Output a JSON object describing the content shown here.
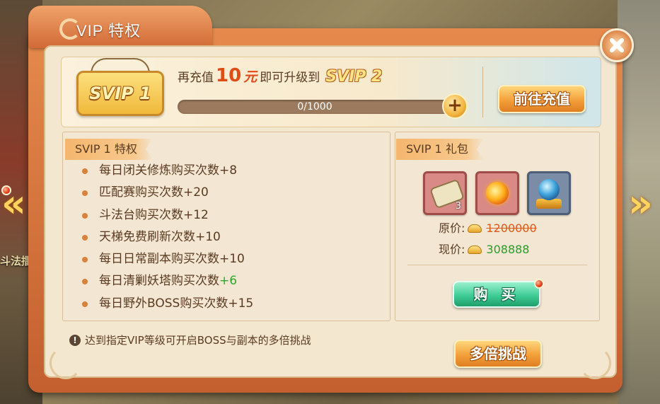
{
  "window": {
    "title": "VIP 特权"
  },
  "background": {
    "scene_text": "斗法擂"
  },
  "banner": {
    "current_level": "SVIP 1",
    "recharge_prefix": "再充值",
    "recharge_amount": "10",
    "recharge_unit": "元",
    "upgrade_text": "即可升级到",
    "next_level": "SVIP 2",
    "progress_label": "0/1000",
    "progress_fraction": 0,
    "recharge_button": "前往充值"
  },
  "privileges": {
    "title": "SVIP 1 特权",
    "items": [
      {
        "text": "每日闭关修炼购买次数+8",
        "bonus": ""
      },
      {
        "text": "匹配赛购买次数+20",
        "bonus": ""
      },
      {
        "text": "斗法台购买次数+12",
        "bonus": ""
      },
      {
        "text": "天梯免费刷新次数+10",
        "bonus": ""
      },
      {
        "text": "每日日常副本购买次数+10",
        "bonus": ""
      },
      {
        "text": "每日清剿妖塔购买次数",
        "bonus": "+6"
      },
      {
        "text": "每日野外BOSS购买次数+15",
        "bonus": ""
      }
    ]
  },
  "gift": {
    "title": "SVIP 1 礼包",
    "items": [
      {
        "icon": "scroll-icon",
        "count": "3"
      },
      {
        "icon": "fire-orb-icon",
        "count": ""
      },
      {
        "icon": "crystal-ball-icon",
        "count": ""
      }
    ],
    "original_label": "原价:",
    "original_price": "1200000",
    "current_label": "现价:",
    "current_price": "308888",
    "buy_button": "购 买"
  },
  "footer": {
    "tip": "达到指定VIP等级可开启BOSS与副本的多倍挑战",
    "multi_button": "多倍挑战"
  },
  "colors": {
    "accent": "#e04c17",
    "price_green": "#2e9a2a",
    "panel": "#f4e7cf",
    "frame": "#d26a36"
  }
}
